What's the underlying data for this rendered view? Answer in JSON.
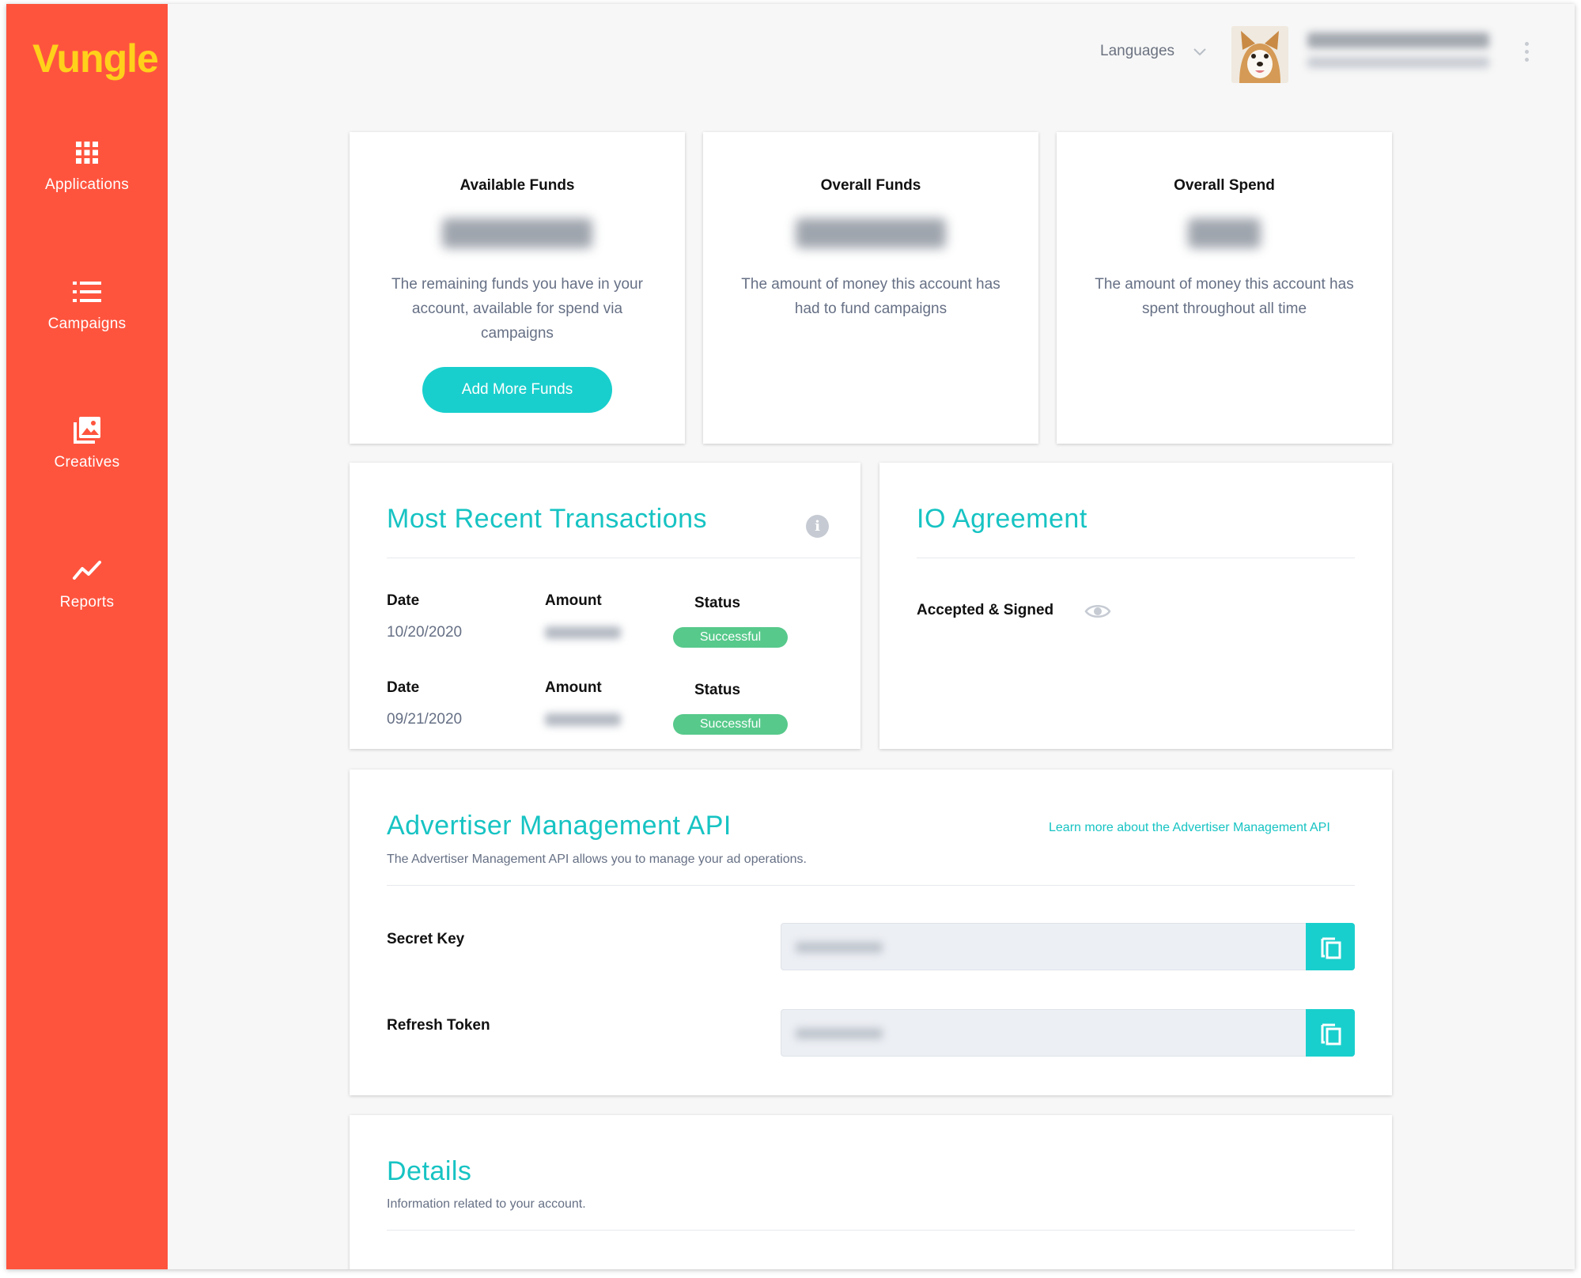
{
  "sidebar": {
    "logo": "Vungle",
    "brand_color": "#fe543e",
    "items": [
      {
        "label": "Applications",
        "icon": "grid-icon"
      },
      {
        "label": "Campaigns",
        "icon": "list-icon"
      },
      {
        "label": "Creatives",
        "icon": "image-stack-icon"
      },
      {
        "label": "Reports",
        "icon": "trend-line-icon"
      }
    ]
  },
  "topbar": {
    "languages_label": "Languages",
    "avatar": "dog-avatar"
  },
  "funds": [
    {
      "title": "Available Funds",
      "description": "The remaining funds you have in your account, available for spend via campaigns",
      "button_label": "Add More Funds"
    },
    {
      "title": "Overall Funds",
      "description": "The amount of money this account has had to fund campaigns"
    },
    {
      "title": "Overall Spend",
      "description": "The amount of money this account has spent throughout all time"
    }
  ],
  "transactions": {
    "title": "Most Recent Transactions",
    "info_icon": "i",
    "rows": [
      {
        "date_label": "Date",
        "amount_label": "Amount",
        "status_label": "Status",
        "date": "10/20/2020",
        "status": "Successful"
      },
      {
        "date_label": "Date",
        "amount_label": "Amount",
        "status_label": "Status",
        "date": "09/21/2020",
        "status": "Successful"
      }
    ]
  },
  "io_agreement": {
    "title": "IO Agreement",
    "status": "Accepted & Signed"
  },
  "api": {
    "title": "Advertiser Management API",
    "subtitle": "The Advertiser Management API allows you to manage your ad operations.",
    "link": "Learn more about the Advertiser Management API",
    "secret_key_label": "Secret Key",
    "refresh_token_label": "Refresh Token"
  },
  "details": {
    "title": "Details",
    "subtitle": "Information related to your account."
  },
  "colors": {
    "accent": "#17c3c3",
    "button": "#19cfcd",
    "success": "#57c98b",
    "logo": "#ffd11a"
  }
}
